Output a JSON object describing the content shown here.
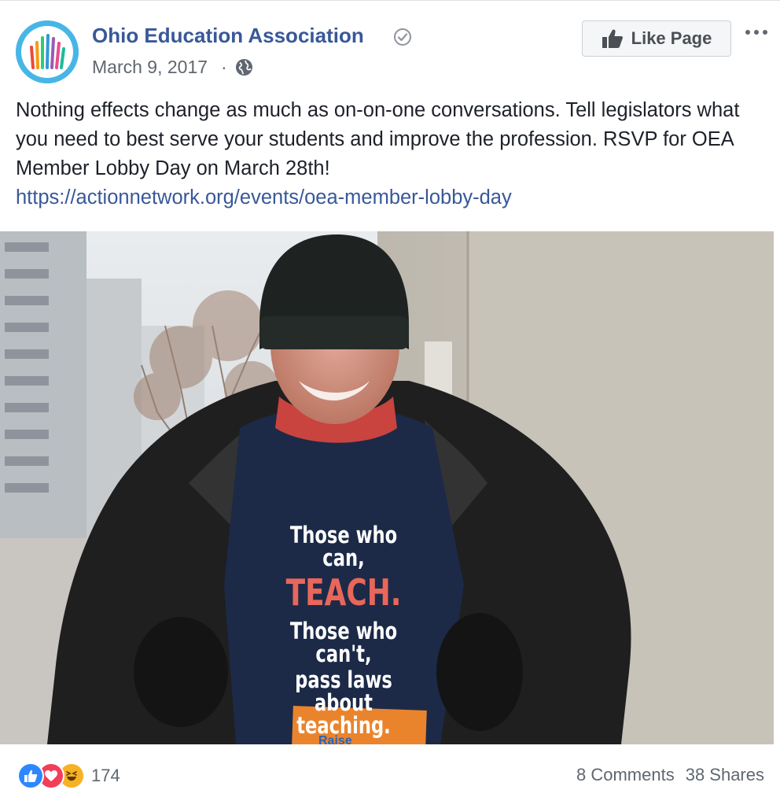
{
  "post": {
    "page_name": "Ohio Education Association",
    "date": "March 9, 2017",
    "date_separator": "·",
    "like_page_label": "Like Page",
    "text": "Nothing effects change as much as on-on-one conversations. Tell legislators what you need to best serve your students and improve the profession. RSVP for OEA Member Lobby Day on March 28th!",
    "link": "https://actionnetwork.org/events/oea-member-lobby-day"
  },
  "photo": {
    "shirt_text": {
      "line1": "Those who can,",
      "line2": "TEACH.",
      "line3": "Those who can't,",
      "line4": "pass laws about teaching."
    },
    "card_text": "Raise"
  },
  "footer": {
    "reaction_count": "174",
    "comments": "8 Comments",
    "shares": "38 Shares"
  },
  "icons": {
    "verified": "verified-check-icon",
    "audience": "globe-icon",
    "like_page": "thumbs-up-icon",
    "more": "more-options-icon",
    "reactions": [
      "like-reaction-icon",
      "love-reaction-icon",
      "haha-reaction-icon"
    ]
  },
  "colors": {
    "link": "#385898",
    "page_name": "#385898",
    "secondary_text": "#606770",
    "like_reaction": "#2d88ff",
    "love_reaction": "#f33e58",
    "haha_reaction": "#f7b125",
    "teach_accent": "#e8675a"
  }
}
